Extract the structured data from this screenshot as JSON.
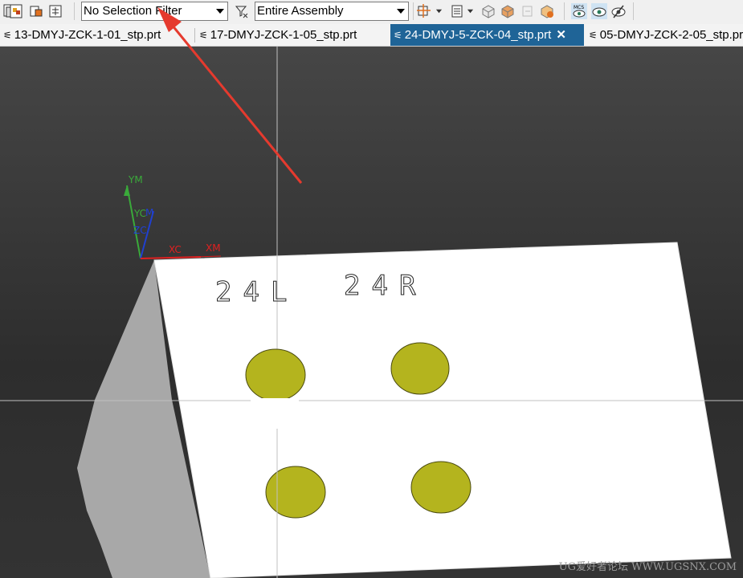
{
  "toolbar": {
    "selection_filter": "No Selection Filter",
    "assembly_scope": "Entire Assembly",
    "icons": [
      "assembly-icon",
      "assembly-view-icon",
      "component-icon",
      "constraint-icon",
      "filter-icon",
      "snap-point-icon",
      "view-style-icon",
      "box-icon",
      "solid-box-icon",
      "face-icon",
      "box-hint-icon",
      "mcs-eye-icon",
      "eye-icon",
      "hide-eye-icon"
    ]
  },
  "tabs": [
    {
      "label": "13-DMYJ-ZCK-1-01_stp.prt",
      "active": false
    },
    {
      "label": "17-DMYJ-ZCK-1-05_stp.prt",
      "active": false
    },
    {
      "label": "24-DMYJ-5-ZCK-04_stp.prt",
      "active": true
    },
    {
      "label": "05-DMYJ-ZCK-2-05_stp.prt",
      "active": false
    }
  ],
  "tab_close": "✕",
  "viewport": {
    "axes": {
      "ym": "YM",
      "yc": "YC",
      "zc": "ZC",
      "zm": "M",
      "xc": "XC",
      "xm": "XM"
    },
    "part_text": {
      "left": "24L",
      "right": "24R"
    },
    "watermark": "UG爱好者论坛 WWW.UGSNX.COM"
  },
  "colors": {
    "tab_active": "#1f6497",
    "hole": "#b4b41e",
    "part_face": "#ffffff",
    "part_side": "#a8a8a8",
    "arrow": "#e53a2e"
  }
}
